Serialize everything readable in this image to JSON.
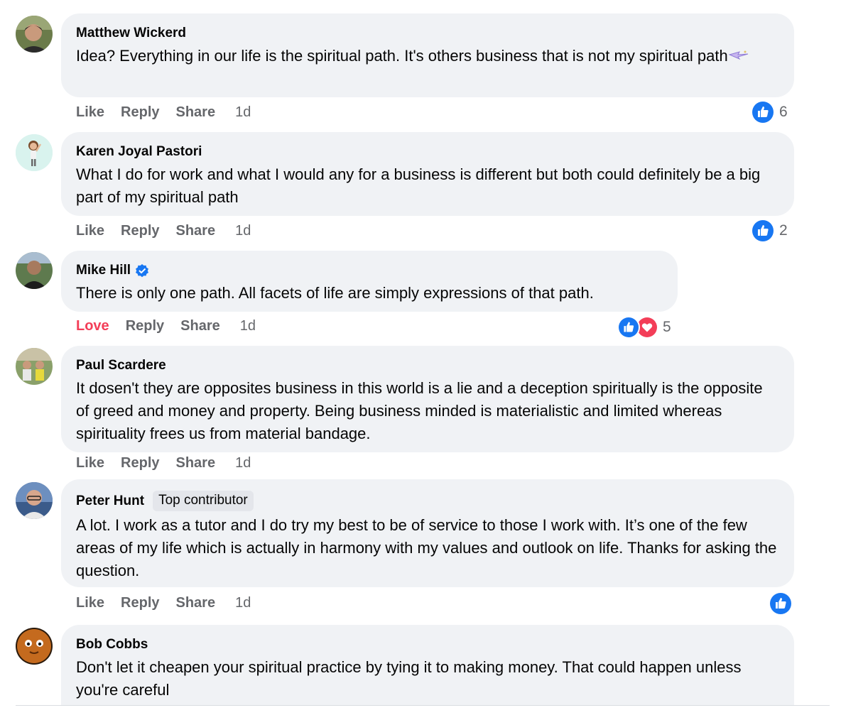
{
  "comments": [
    {
      "author": "Matthew Wickerd",
      "text": "Idea? Everything in our life is the spiritual path. It's others business that is not my spiritual path",
      "actions": {
        "like": "Like",
        "reply": "Reply",
        "share": "Share",
        "time": "1d"
      },
      "reactions": {
        "count": "6",
        "icons": [
          "like-icon"
        ]
      }
    },
    {
      "author": "Karen Joyal Pastori",
      "text": "What I do for work and what I would any for a business is different but both could definitely be a big part of my spiritual path",
      "actions": {
        "like": "Like",
        "reply": "Reply",
        "share": "Share",
        "time": "1d"
      },
      "reactions": {
        "count": "2",
        "icons": [
          "like-icon"
        ]
      }
    },
    {
      "author": "Mike Hill",
      "verified": true,
      "text": "There is only one path. All facets of life are simply expressions of that path.",
      "actions": {
        "like": "Love",
        "reply": "Reply",
        "share": "Share",
        "time": "1d"
      },
      "reactions": {
        "count": "5",
        "icons": [
          "like-icon",
          "heart-icon"
        ]
      }
    },
    {
      "author": "Paul Scardere",
      "text": "It dosen't they are opposites business in this world is a lie and a deception spiritually is the opposite of greed and money and property. Being business minded is materialistic and limited whereas spirituality frees us from material bandage.",
      "actions": {
        "like": "Like",
        "reply": "Reply",
        "share": "Share",
        "time": "1d"
      }
    },
    {
      "author": "Peter Hunt",
      "badge": "Top contributor",
      "text": "A lot. I work as a tutor and I do try my best to be of service to those I work with. It’s one of the few areas of my life which is actually in harmony with my values and outlook on life. Thanks for asking the question.",
      "actions": {
        "like": "Like",
        "reply": "Reply",
        "share": "Share",
        "time": "1d"
      },
      "reactions": {
        "icons": [
          "like-icon"
        ]
      }
    },
    {
      "author": "Bob Cobbs",
      "text": "Don't let it cheapen your spiritual practice by tying it to making money. That could happen unless you're careful"
    }
  ],
  "colors": {
    "like_blue": "#1877f2",
    "love_red": "#f33e58",
    "bubble_bg": "#f0f2f5",
    "muted": "#65676b"
  }
}
